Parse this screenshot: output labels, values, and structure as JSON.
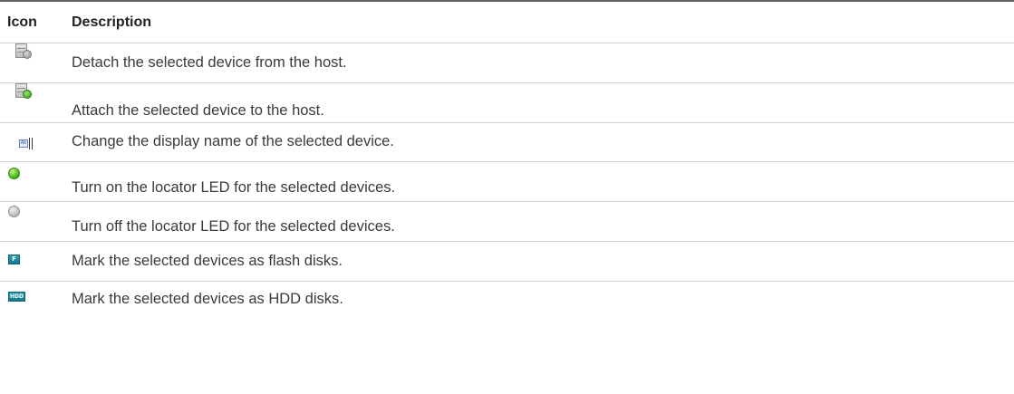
{
  "table": {
    "headers": {
      "icon": "Icon",
      "description": "Description"
    },
    "rows": [
      {
        "icon": "detach-device-icon",
        "description": "Detach the selected device from the host."
      },
      {
        "icon": "attach-device-icon",
        "description": "Attach the selected device to the host."
      },
      {
        "icon": "rename-device-icon",
        "icon_text": "Ab",
        "description": "Change the display name of the selected device."
      },
      {
        "icon": "locator-led-on-icon",
        "description": "Turn on the locator LED for the selected devices."
      },
      {
        "icon": "locator-led-off-icon",
        "description": "Turn off the locator LED for the selected devices."
      },
      {
        "icon": "flash-disk-icon",
        "icon_text": "F",
        "description": "Mark the selected devices as flash disks."
      },
      {
        "icon": "hdd-disk-icon",
        "icon_text": "HDD",
        "description": "Mark the selected devices as HDD disks."
      }
    ]
  },
  "colors": {
    "rule": "#5f5f5f",
    "row_divider": "#d0d0d0",
    "text": "#3a3a3a",
    "badge_teal": "#1a8ba0",
    "led_green": "#4cba1c"
  }
}
